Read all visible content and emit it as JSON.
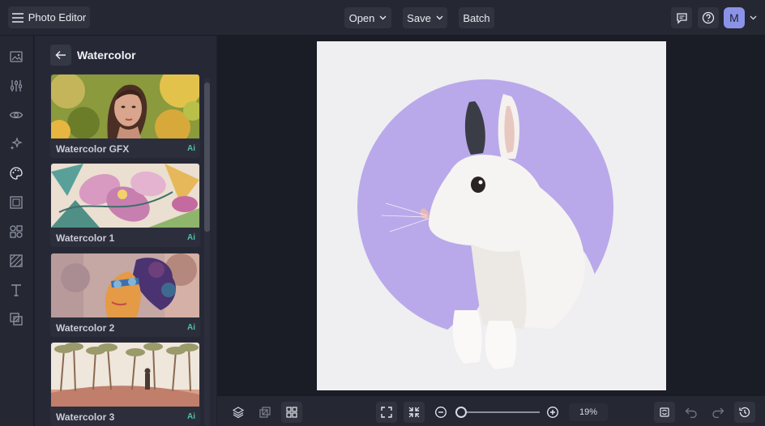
{
  "app": {
    "title": "Photo Editor"
  },
  "toolbar": {
    "open_label": "Open",
    "save_label": "Save",
    "batch_label": "Batch",
    "avatar_letter": "M"
  },
  "rail": {
    "icons": [
      "image-icon",
      "sliders-icon",
      "eye-icon",
      "sparkle-icon",
      "palette-icon",
      "frame-icon",
      "shapes-icon",
      "texture-icon",
      "text-icon",
      "overlay-icon"
    ],
    "active_index": 4
  },
  "panel": {
    "title": "Watercolor",
    "effects": [
      {
        "label": "Watercolor GFX",
        "badge": "Ai"
      },
      {
        "label": "Watercolor 1",
        "badge": "Ai"
      },
      {
        "label": "Watercolor 2",
        "badge": "Ai"
      },
      {
        "label": "Watercolor 3",
        "badge": "Ai"
      }
    ]
  },
  "canvas": {
    "background_color": "#efeef1",
    "circle_color": "#b9a9ea"
  },
  "bottom": {
    "zoom_level": "19%"
  },
  "colors": {
    "accent": "#8b93e8",
    "ai_badge": "#4fc0a8"
  }
}
